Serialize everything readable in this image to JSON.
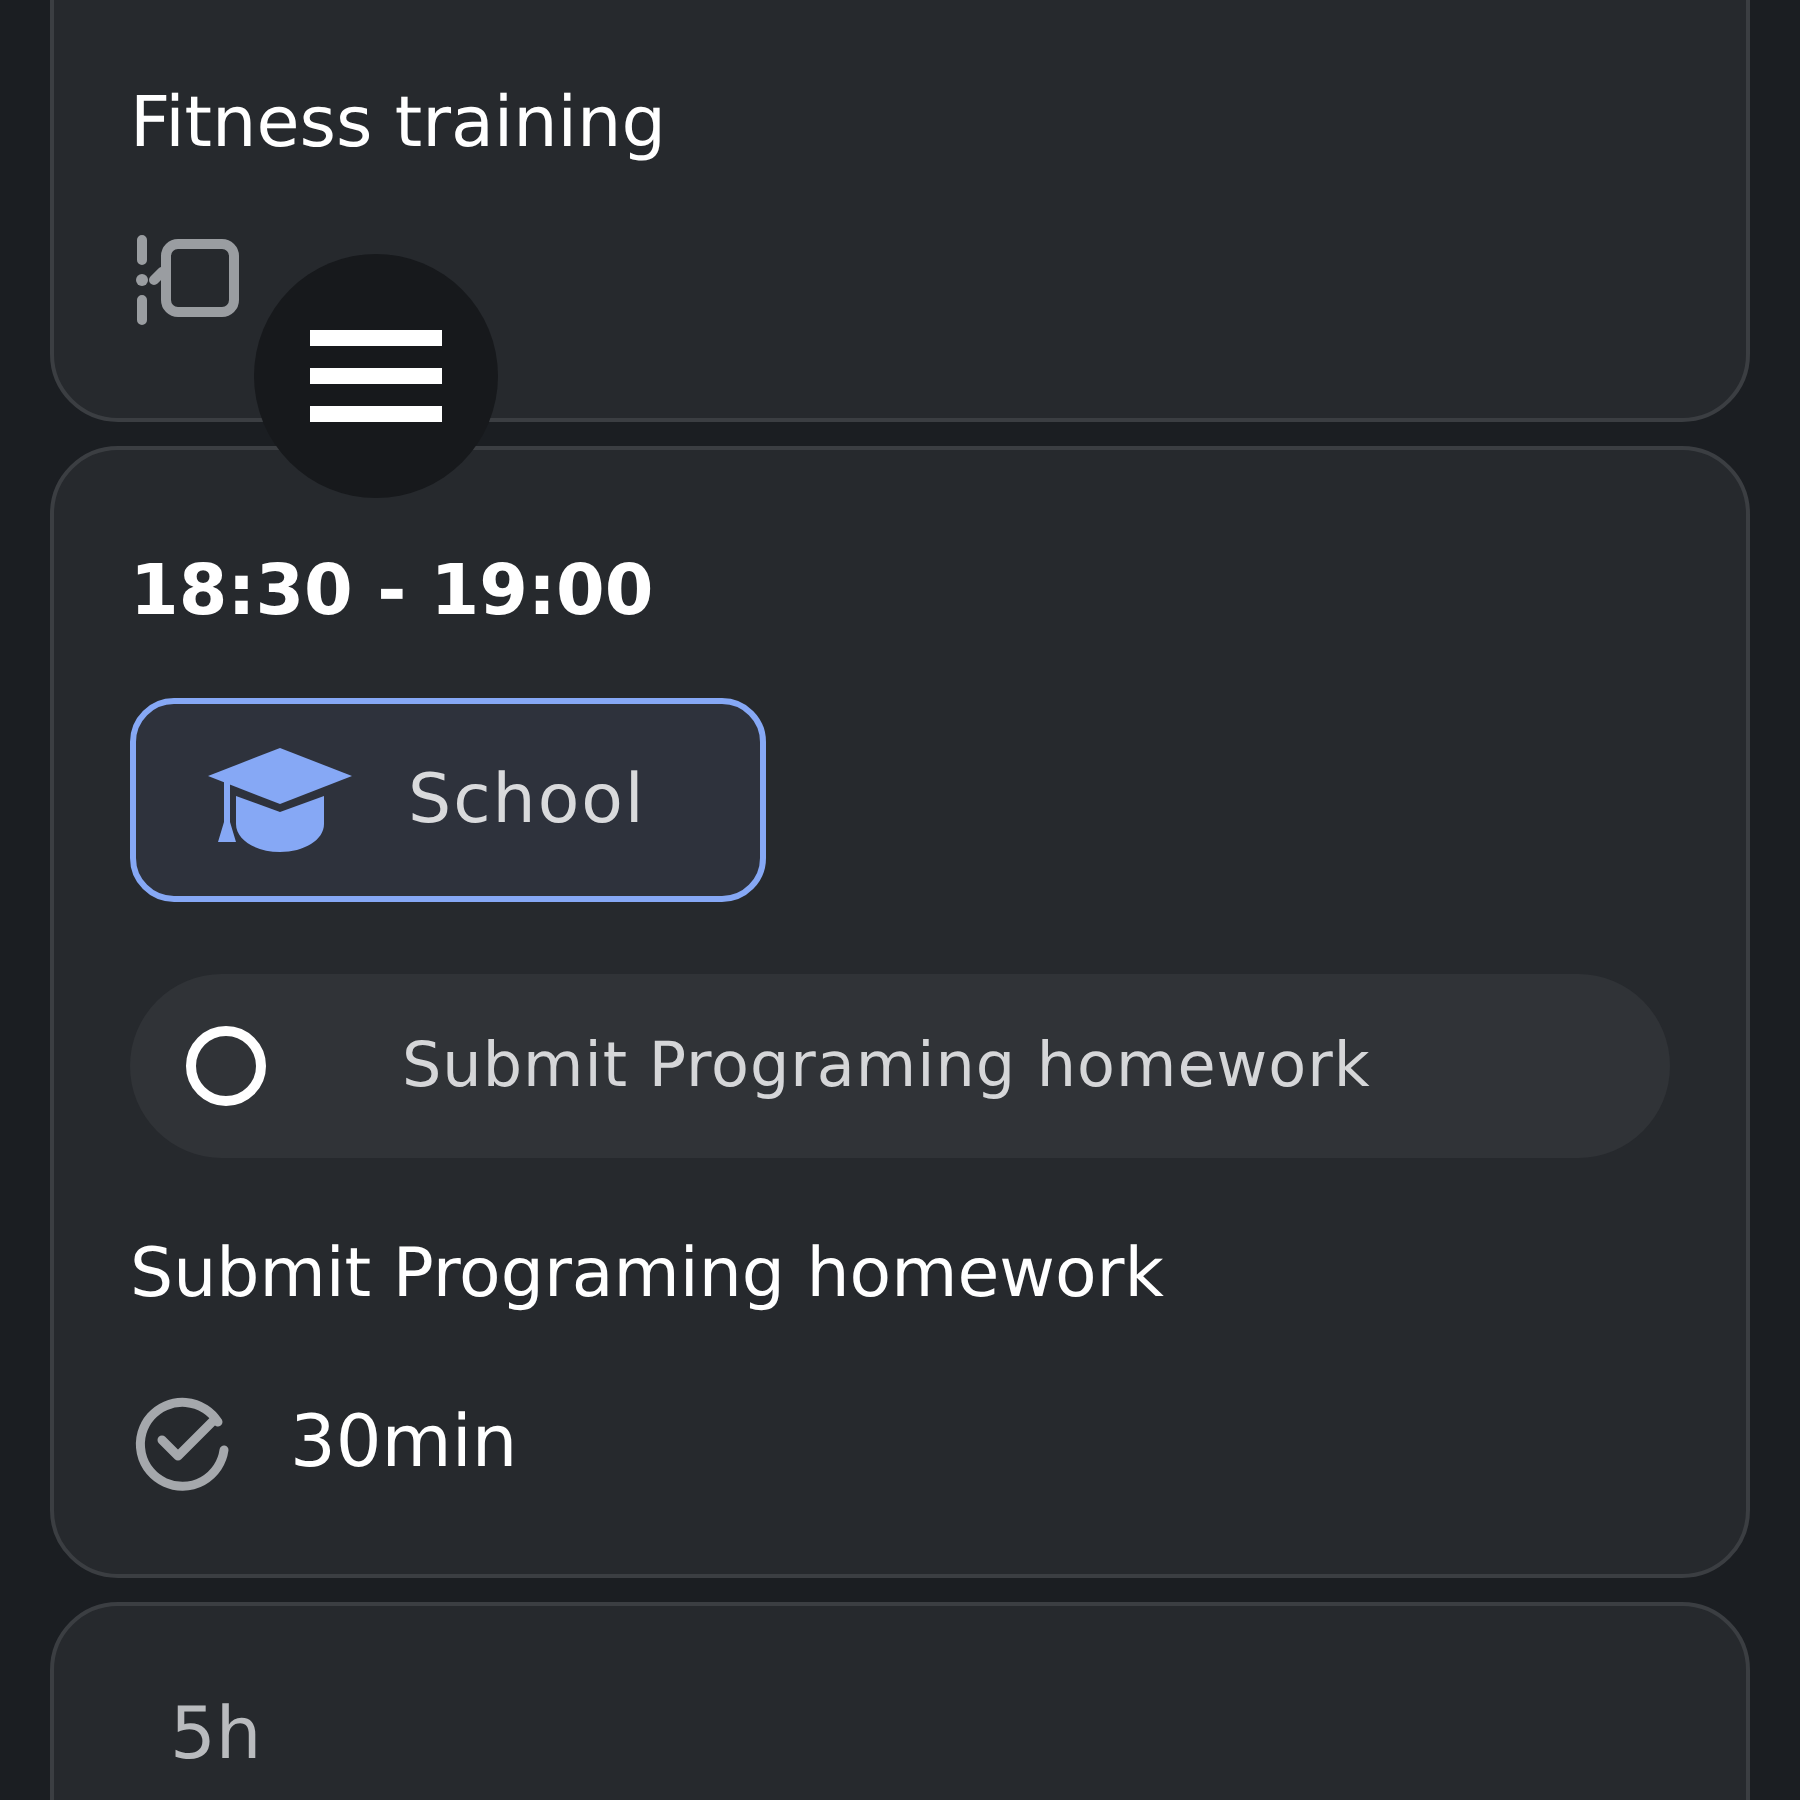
{
  "events": [
    {
      "kind": "partial",
      "title": "Fitness training"
    },
    {
      "kind": "full",
      "time": "18:30 - 19:00",
      "category": {
        "label": "School",
        "color": "#86a8f5"
      },
      "task": {
        "label": "Submit Programing homework",
        "checked": false
      },
      "title": "Submit Programing homework",
      "duration": "30min"
    },
    {
      "kind": "summary",
      "duration": "5h"
    }
  ]
}
